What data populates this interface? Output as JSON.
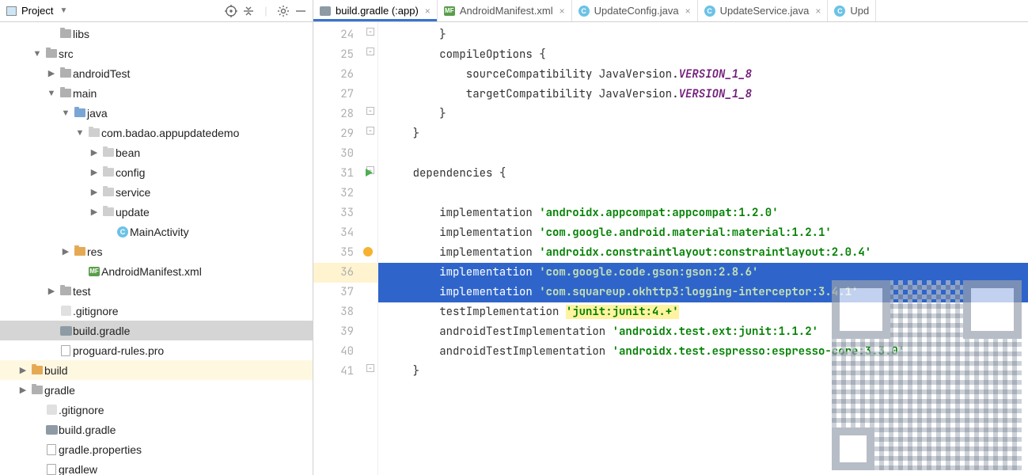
{
  "sidebar": {
    "title": "Project",
    "tree": {
      "libs": "libs",
      "src": "src",
      "androidTest": "androidTest",
      "main": "main",
      "java": "java",
      "package": "com.badao.appupdatedemo",
      "bean": "bean",
      "config": "config",
      "service": "service",
      "update": "update",
      "mainActivity": "MainActivity",
      "res": "res",
      "manifest": "AndroidManifest.xml",
      "test": "test",
      "gitignoreApp": ".gitignore",
      "buildGradleApp": "build.gradle",
      "proguard": "proguard-rules.pro",
      "build": "build",
      "gradle": "gradle",
      "gitignoreRoot": ".gitignore",
      "buildGradleRoot": "build.gradle",
      "gradleProps": "gradle.properties",
      "gradlew": "gradlew"
    }
  },
  "tabs": {
    "t1": "build.gradle (:app)",
    "t2": "AndroidManifest.xml",
    "t3": "UpdateConfig.java",
    "t4": "UpdateService.java",
    "t5": "Upd"
  },
  "code": {
    "lines": [
      "24",
      "25",
      "26",
      "27",
      "28",
      "29",
      "30",
      "31",
      "32",
      "33",
      "34",
      "35",
      "36",
      "37",
      "38",
      "39",
      "40",
      "41"
    ],
    "l24": "        }",
    "l25_a": "        compileOptions ",
    "l25_b": "{",
    "l26_a": "            sourceCompatibility JavaVersion.",
    "l26_b": "VERSION_1_8",
    "l27_a": "            targetCompatibility JavaVersion.",
    "l27_b": "VERSION_1_8",
    "l28": "        }",
    "l29": "    }",
    "l30": "",
    "l31_a": "    dependencies ",
    "l31_b": "{",
    "l32": "",
    "l33_a": "        implementation ",
    "l33_b": "'androidx.appcompat:appcompat:1.2.0'",
    "l34_a": "        implementation ",
    "l34_b": "'com.google.android.material:material:1.2.1'",
    "l35_a": "        implementation ",
    "l35_b": "'androidx.constraintlayout:constraintlayout:2.0.4'",
    "l36_a": "        implementation ",
    "l36_b": "'com.google.code.gson:gson:2.8.6'",
    "l37_a": "        implementation ",
    "l37_b": "'com.squareup.okhttp3:logging-interceptor:3.4.1'",
    "l38_a": "        testImplementation ",
    "l38_b": "'junit:junit:4.+'",
    "l39_a": "        androidTestImplementation ",
    "l39_b": "'androidx.test.ext:junit:1.1.2'",
    "l40_a": "        androidTestImplementation ",
    "l40_b": "'androidx.test.espresso:espresso-core:3.3.0'",
    "l41": "    }"
  }
}
